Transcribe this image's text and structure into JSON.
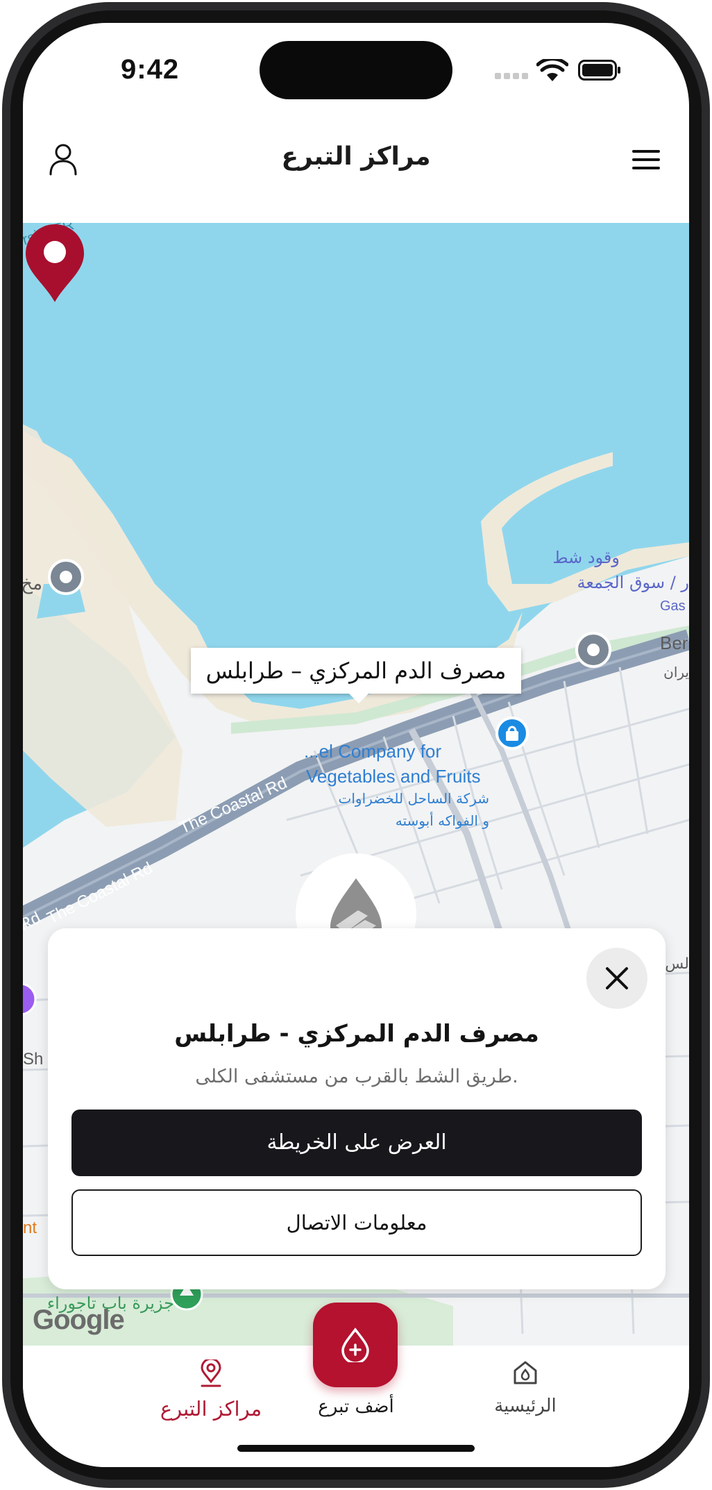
{
  "status_bar": {
    "time": "9:42"
  },
  "app_bar": {
    "title": "مراكز التبرع"
  },
  "map": {
    "callout_title": "مصرف الدم المركزي – طرابلس",
    "labels": {
      "road_1": "The Coastal Rd",
      "road_2": "The Coastal Rd",
      "road_3": "Rd",
      "poi_company_en_1": "...el Company for",
      "poi_company_en_2": "Vegetables and Fruits",
      "poi_company_ar_1": "شركة الساحل للخضراوات",
      "poi_company_ar_2": "و الفواكه أبوسته",
      "fuel_1": "وقود شط",
      "fuel_2": "ر / سوق الجمعة",
      "gas": "Gas",
      "corner": "rsin, TR",
      "ber": "Ber",
      "biran": "يران",
      "mukh": "مخ",
      "island": "جزيرة باب تاجوراء",
      "sh": "Sh",
      "nt": "nt",
      "lus": "لس"
    },
    "attribution": "Google"
  },
  "detail_sheet": {
    "title": "مصرف الدم المركزي - طرابلس",
    "address": "طريق الشط بالقرب من مستشفى الكلى.",
    "view_on_map": "العرض على الخريطة",
    "contact_info": "معلومات الاتصال"
  },
  "tab_bar": {
    "donation_centers": "مراكز التبرع",
    "add_donation": "أضف تبرع",
    "home": "الرئيسية"
  },
  "colors": {
    "accent": "#b4122f",
    "water": "#8fd6ec",
    "dark_button": "#18181c"
  }
}
